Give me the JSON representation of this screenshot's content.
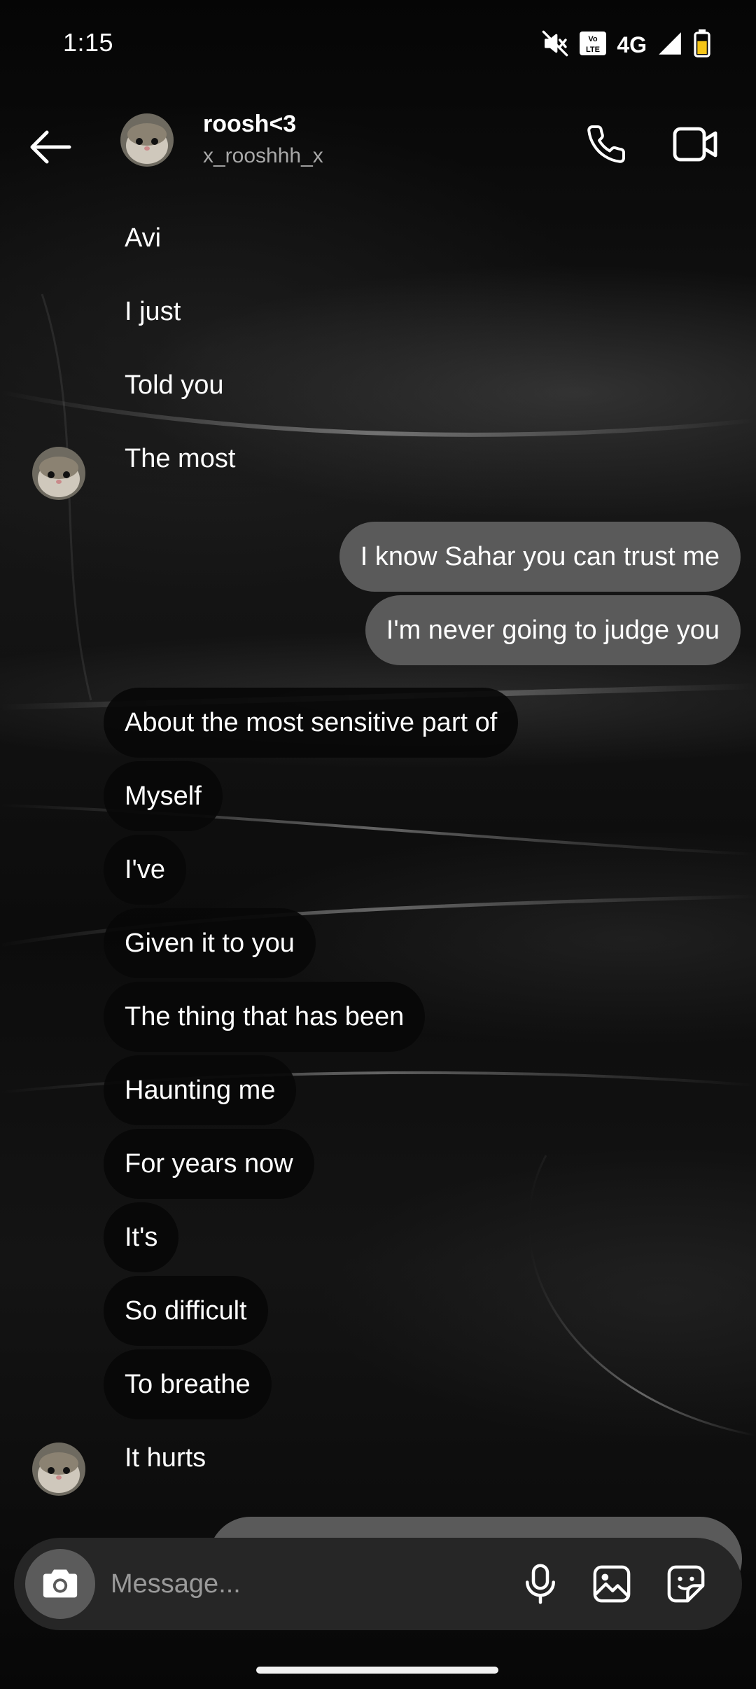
{
  "status_bar": {
    "time": "1:15",
    "network": "4G",
    "icons": [
      "mute-icon",
      "volte-icon",
      "signal-icon",
      "battery-icon"
    ]
  },
  "header": {
    "name": "roosh<3",
    "handle": "x_rooshhh_x",
    "icons": [
      "back-arrow-icon",
      "avatar",
      "phone-icon",
      "video-camera-icon"
    ]
  },
  "messages": [
    {
      "dir": "in",
      "text": "Avi"
    },
    {
      "dir": "in",
      "text": "I just"
    },
    {
      "dir": "in",
      "text": "Told you"
    },
    {
      "dir": "in",
      "text": "The most"
    },
    {
      "dir": "out",
      "text": "I know Sahar you can trust me"
    },
    {
      "dir": "out",
      "text": "I'm never going to judge you"
    },
    {
      "dir": "in",
      "text": "About the most sensitive part of"
    },
    {
      "dir": "in",
      "text": "Myself"
    },
    {
      "dir": "in",
      "text": "I've"
    },
    {
      "dir": "in",
      "text": "Given it to you"
    },
    {
      "dir": "in",
      "text": "The thing that has been"
    },
    {
      "dir": "in",
      "text": "Haunting me"
    },
    {
      "dir": "in",
      "text": "For years now"
    },
    {
      "dir": "in",
      "text": "It's"
    },
    {
      "dir": "in",
      "text": "So difficult"
    },
    {
      "dir": "in",
      "text": "To breathe"
    },
    {
      "dir": "in",
      "text": "It hurts"
    }
  ],
  "composer": {
    "placeholder": "Message...",
    "icons": [
      "camera-icon",
      "microphone-icon",
      "gallery-icon",
      "sticker-icon"
    ]
  },
  "colors": {
    "outgoing_bubble": "#5a5a5a",
    "incoming_bubble": "#080808",
    "composer": "#262626",
    "handle_text": "#a8a8a8"
  }
}
